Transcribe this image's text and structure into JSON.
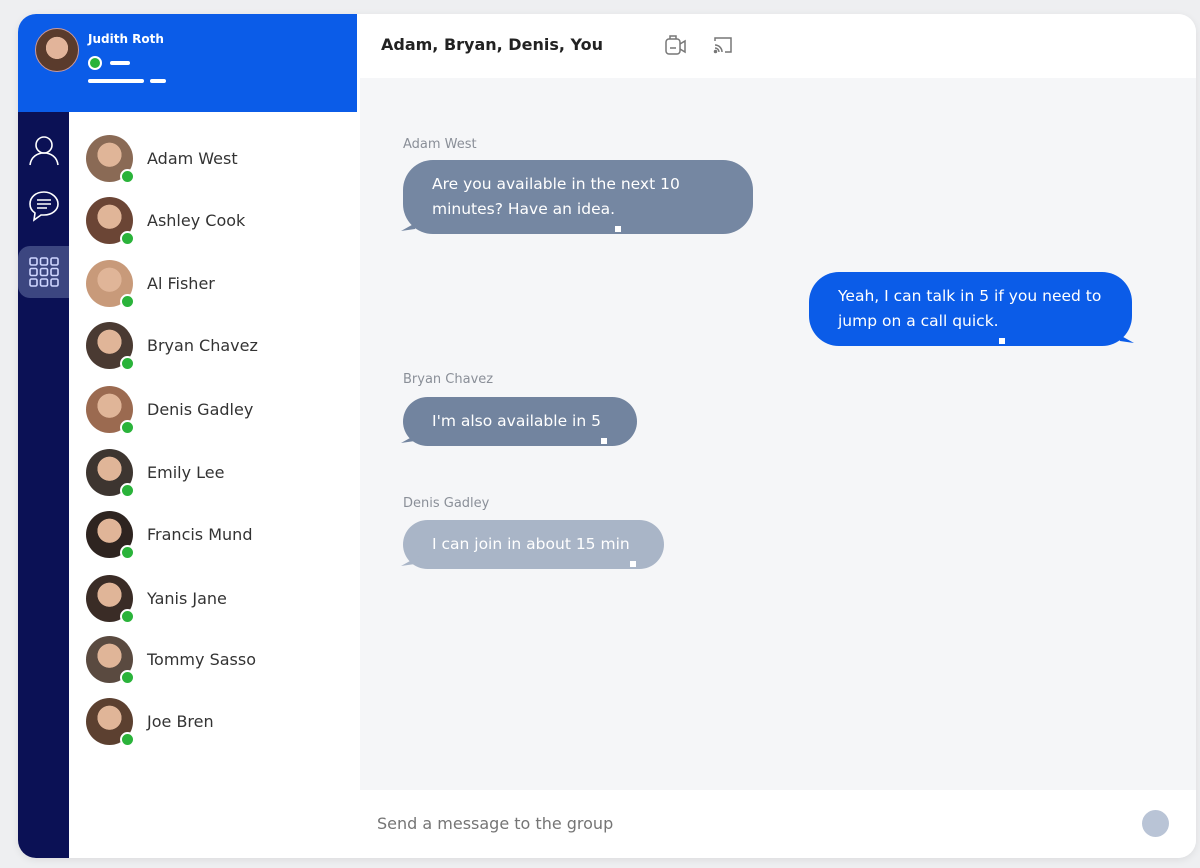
{
  "user": {
    "name": "Judith Roth",
    "status": "online"
  },
  "nav": [
    {
      "icon": "user-icon"
    },
    {
      "icon": "chat-icon"
    },
    {
      "icon": "grid-icon",
      "active": true
    }
  ],
  "contacts": [
    {
      "name": "Adam West",
      "color": "#8a6a55"
    },
    {
      "name": "Ashley Cook",
      "color": "#6b4535"
    },
    {
      "name": "Al Fisher",
      "color": "#c89a7a"
    },
    {
      "name": "Bryan Chavez",
      "color": "#4a3a32"
    },
    {
      "name": "Denis Gadley",
      "color": "#9b6a50"
    },
    {
      "name": "Emily Lee",
      "color": "#3d3530"
    },
    {
      "name": "Francis Mund",
      "color": "#2e2420"
    },
    {
      "name": "Yanis Jane",
      "color": "#3a2c26"
    },
    {
      "name": "Tommy Sasso",
      "color": "#5a4a40"
    },
    {
      "name": "Joe Bren",
      "color": "#5c4030"
    }
  ],
  "chat": {
    "title": "Adam, Bryan, Denis, You",
    "messages": [
      {
        "sender": "Adam West",
        "text": "Are you available in the next 10 minutes? Have an idea.",
        "color": "#7587a2"
      },
      {
        "sender": "",
        "text": "Yeah, I can talk in 5 if you need to jump on a call quick.",
        "color": "#0b5ce8"
      },
      {
        "sender": "Bryan Chavez",
        "text": "I'm also available in 5",
        "color": "#72849f"
      },
      {
        "sender": "Denis Gadley",
        "text": "I can join in about 15 min",
        "color": "#a9b5c7"
      }
    ],
    "input_placeholder": "Send a message to the group"
  },
  "colors": {
    "primary": "#0b5ce8",
    "nav": "#0b1155",
    "online": "#2ab33a"
  }
}
